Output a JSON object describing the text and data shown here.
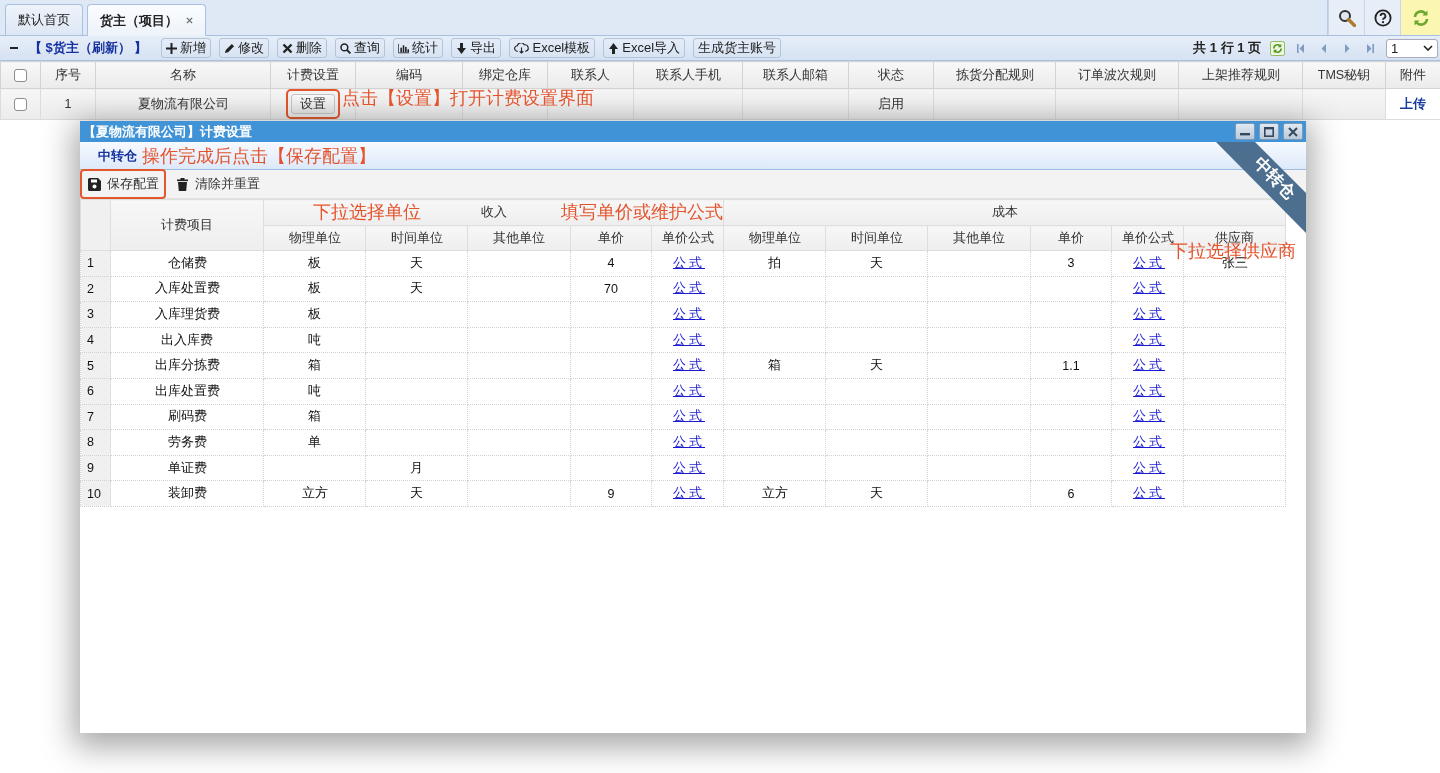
{
  "tabs": [
    {
      "label": "默认首页",
      "selected": false,
      "closable": false
    },
    {
      "label": "货主（项目）",
      "selected": true,
      "closable": true
    }
  ],
  "toolbar": {
    "title": "【 $货主（刷新） 】",
    "buttons": [
      {
        "label": "新增",
        "kind": "add"
      },
      {
        "label": "修改",
        "kind": "edit"
      },
      {
        "label": "删除",
        "kind": "delete"
      },
      {
        "label": "查询",
        "kind": "search"
      },
      {
        "label": "统计",
        "kind": "stats"
      },
      {
        "label": "导出",
        "kind": "export"
      },
      {
        "label": "Excel模板",
        "kind": "template"
      },
      {
        "label": "Excel导入",
        "kind": "import"
      },
      {
        "label": "生成货主账号",
        "kind": "plain"
      }
    ]
  },
  "pager": {
    "summary": "共 1 行 1 页",
    "page": "1"
  },
  "grid": {
    "header_checked": false,
    "columns": [
      "序号",
      "名称",
      "计费设置",
      "编码",
      "绑定仓库",
      "联系人",
      "联系人手机",
      "联系人邮箱",
      "状态",
      "拣货分配规则",
      "订单波次规则",
      "上架推荐规则",
      "TMS秘钥",
      "附件"
    ],
    "rows": [
      {
        "checked": false,
        "cells": [
          {
            "kind": "text",
            "text": "1"
          },
          {
            "kind": "text",
            "text": "夏物流有限公司"
          },
          {
            "kind": "button",
            "text": "设置",
            "highlighted": true
          },
          null,
          null,
          null,
          null,
          null,
          {
            "kind": "text",
            "text": "启用"
          },
          null,
          null,
          null,
          null,
          {
            "kind": "link",
            "text": "上传"
          }
        ]
      }
    ]
  },
  "dialog": {
    "title": "【夏物流有限公司】计费设置",
    "warehouse": "中转仓",
    "ribbon": "中转仓",
    "actions": [
      {
        "label": "保存配置",
        "kind": "save",
        "highlighted": true
      },
      {
        "label": "清除并重置",
        "kind": "clear",
        "highlighted": false
      }
    ],
    "table": {
      "item_header": "计费项目",
      "groups": [
        {
          "label": "收入",
          "columns": [
            "物理单位",
            "时间单位",
            "其他单位",
            "单价",
            "单价公式"
          ]
        },
        {
          "label": "成本",
          "columns": [
            "物理单位",
            "时间单位",
            "其他单位",
            "单价",
            "单价公式",
            "供应商"
          ]
        }
      ],
      "rows": [
        {
          "no": "1",
          "item": "仓储费",
          "cells": [
            "板",
            "天",
            null,
            "4",
            {
              "kind": "link",
              "text": "公式"
            },
            "拍",
            "天",
            null,
            "3",
            {
              "kind": "link",
              "text": "公式"
            },
            "张三"
          ]
        },
        {
          "no": "2",
          "item": "入库处置费",
          "cells": [
            "板",
            "天",
            null,
            "70",
            {
              "kind": "link",
              "text": "公式"
            },
            null,
            null,
            null,
            null,
            {
              "kind": "link",
              "text": "公式"
            },
            null
          ]
        },
        {
          "no": "3",
          "item": "入库理货费",
          "cells": [
            "板",
            null,
            null,
            null,
            {
              "kind": "link",
              "text": "公式"
            },
            null,
            null,
            null,
            null,
            {
              "kind": "link",
              "text": "公式"
            },
            null
          ]
        },
        {
          "no": "4",
          "item": "出入库费",
          "cells": [
            "吨",
            null,
            null,
            null,
            {
              "kind": "link",
              "text": "公式"
            },
            null,
            null,
            null,
            null,
            {
              "kind": "link",
              "text": "公式"
            },
            null
          ]
        },
        {
          "no": "5",
          "item": "出库分拣费",
          "cells": [
            "箱",
            null,
            null,
            null,
            {
              "kind": "link",
              "text": "公式"
            },
            "箱",
            "天",
            null,
            "1.1",
            {
              "kind": "link",
              "text": "公式"
            },
            null
          ]
        },
        {
          "no": "6",
          "item": "出库处置费",
          "cells": [
            "吨",
            null,
            null,
            null,
            {
              "kind": "link",
              "text": "公式"
            },
            null,
            null,
            null,
            null,
            {
              "kind": "link",
              "text": "公式"
            },
            null
          ]
        },
        {
          "no": "7",
          "item": "刷码费",
          "cells": [
            "箱",
            null,
            null,
            null,
            {
              "kind": "link",
              "text": "公式"
            },
            null,
            null,
            null,
            null,
            {
              "kind": "link",
              "text": "公式"
            },
            null
          ]
        },
        {
          "no": "8",
          "item": "劳务费",
          "cells": [
            "单",
            null,
            null,
            null,
            {
              "kind": "link",
              "text": "公式"
            },
            null,
            null,
            null,
            null,
            {
              "kind": "link",
              "text": "公式"
            },
            null
          ]
        },
        {
          "no": "9",
          "item": "单证费",
          "cells": [
            null,
            "月",
            null,
            null,
            {
              "kind": "link",
              "text": "公式"
            },
            null,
            null,
            null,
            null,
            {
              "kind": "link",
              "text": "公式"
            },
            null
          ]
        },
        {
          "no": "10",
          "item": "装卸费",
          "cells": [
            "立方",
            "天",
            null,
            "9",
            {
              "kind": "link",
              "text": "公式"
            },
            "立方",
            "天",
            null,
            "6",
            {
              "kind": "link",
              "text": "公式"
            },
            null
          ]
        }
      ]
    }
  },
  "annotations": [
    "点击【设置】打开计费设置界面",
    "操作完成后点击【保存配置】",
    "下拉选择单位",
    "填写单价或维护公式",
    "下拉选择供应商"
  ]
}
